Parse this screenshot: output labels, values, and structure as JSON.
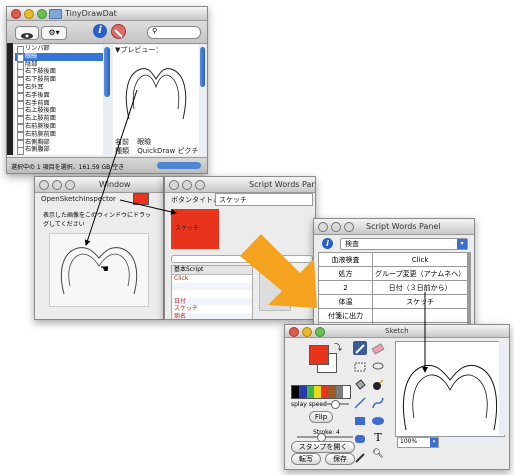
{
  "finder": {
    "title": "TinyDrawDat",
    "search_placeholder": "",
    "files": [
      "リンパ節",
      "眼瞼",
      "陰部",
      "右下肢後面",
      "右下肢前面",
      "右外耳",
      "右手後面",
      "右手前面",
      "右上肢後面",
      "右上肢前面",
      "右前腕後面",
      "右前腕前面",
      "右側胸部",
      "右側腹部"
    ],
    "selected_index": 1,
    "preview_label": "▼プレビュー：",
    "info_name_label": "名前",
    "info_name_value": "眼瞼",
    "info_kind_label": "種類",
    "info_kind_value": "QuickDraw ピクチャ",
    "status": "選択中の 1 項目を選択、161.59 GB 空き"
  },
  "inspector": {
    "title": "Window",
    "header": "OpenSketchInspector",
    "description": "表示した画像をこのウィンドウにドラッグしてください"
  },
  "scriptwords_back": {
    "title": "Script Words Panel",
    "button_title_label": "ボタンタイトル",
    "button_title_value": "スケッチ",
    "red_button_label": "スケッチ",
    "list_header": "基本Script",
    "list_items": [
      "Click",
      "",
      "",
      "日付",
      "スケッチ",
      "病名"
    ]
  },
  "scriptwords_front": {
    "title": "Script Words Panel",
    "search_value": "検査",
    "rows": [
      [
        "血液検査",
        "Click"
      ],
      [
        "処方",
        "グループ変更（アナムネへ）"
      ],
      [
        "2",
        "日付（３日前から）"
      ],
      [
        "体温",
        "スケッチ"
      ],
      [
        "付箋に出力",
        ""
      ],
      [
        "カーソル＆表示",
        ""
      ]
    ]
  },
  "sketch": {
    "title": "Sketch",
    "spray_label": "splay speed",
    "flip_label": "Flip",
    "stroke_label": "Stroke: 4",
    "stamp_button": "スタンプを開く",
    "transfer_button": "転写",
    "save_button": "保存",
    "zoom_value": "100%",
    "colors": {
      "fill": "#e8341c",
      "accent": "#f5a21e"
    }
  }
}
